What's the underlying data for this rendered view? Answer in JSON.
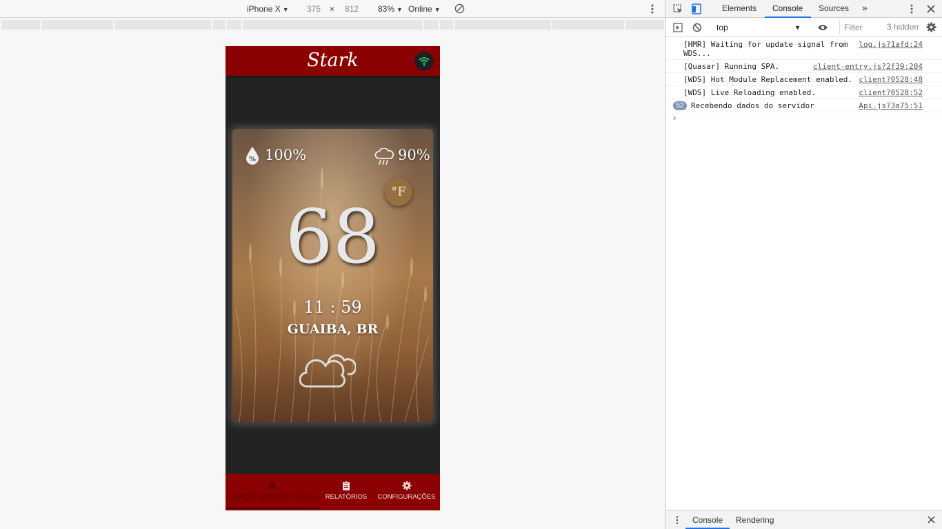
{
  "device_toolbar": {
    "device": "iPhone X",
    "width": "375",
    "times": "×",
    "height": "812",
    "zoom": "83%",
    "throttle": "Online"
  },
  "app": {
    "title": "Stark",
    "card": {
      "humidity": "100%",
      "rain_chance": "90%",
      "unit_toggle": "°F",
      "temperature": "68",
      "time": "11 : 59",
      "location": "GUAIBA, BR"
    },
    "nav": {
      "estacao": "ESTAÇÃO METEOROLÓGICA",
      "relatorios": "RELATÓRIOS",
      "configuracoes": "CONFIGURAÇÕES"
    },
    "colors": {
      "primary": "#8b0000",
      "background": "#232323"
    }
  },
  "devtools": {
    "tabs": {
      "elements": "Elements",
      "console": "Console",
      "sources": "Sources"
    },
    "context": "top",
    "filter_placeholder": "Filter",
    "hidden": "3 hidden",
    "logs": [
      {
        "msg": "[HMR] Waiting for update signal from\nWDS...",
        "src": "log.js?1afd:24"
      },
      {
        "msg": "[Quasar] Running SPA.",
        "src": "client-entry.js?2f39:204"
      },
      {
        "msg": "[WDS] Hot Module Replacement enabled.",
        "src": "client?0528:48"
      },
      {
        "msg": "[WDS] Live Reloading enabled.",
        "src": "client?0528:52"
      },
      {
        "msg": "Recebendo dados do servidor",
        "src": "Api.js?3a75:51",
        "count": "52"
      }
    ],
    "drawer": {
      "console": "Console",
      "rendering": "Rendering"
    }
  }
}
